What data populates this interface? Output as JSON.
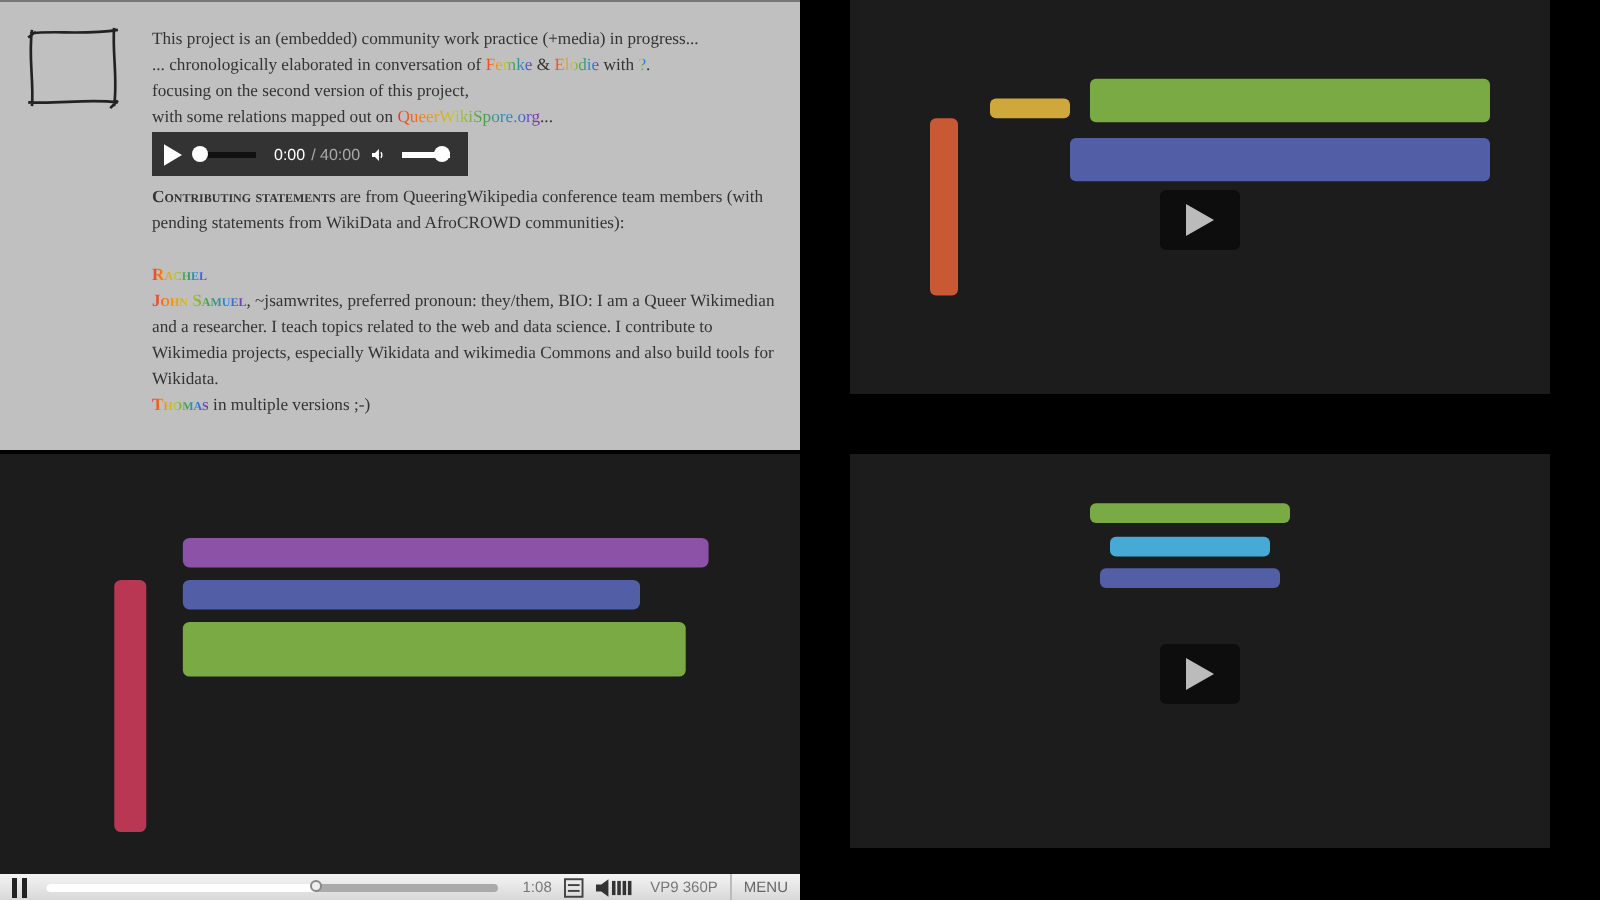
{
  "intro": {
    "lines": [
      [
        {
          "kind": "plain",
          "text": "This project is an (embedded) community work practice (+media) in progress..."
        }
      ],
      [
        {
          "kind": "plain",
          "text": "... chronologically elaborated in conversation of "
        },
        {
          "kind": "link",
          "text": "Femke"
        },
        {
          "kind": "plain",
          "text": " & "
        },
        {
          "kind": "link",
          "text": "Elodie"
        },
        {
          "kind": "plain",
          "text": " with "
        },
        {
          "kind": "link",
          "text": "?"
        },
        {
          "kind": "plain",
          "text": "."
        }
      ],
      [
        {
          "kind": "plain",
          "text": "focusing on the second version of this project,"
        }
      ],
      [
        {
          "kind": "plain",
          "text": "with some relations mapped out on "
        },
        {
          "kind": "link",
          "text": "QueerWikiSpore.org"
        },
        {
          "kind": "plain",
          "text": "..."
        }
      ]
    ]
  },
  "audio": {
    "playing": false,
    "seek": {
      "level": 0
    },
    "time": "0:00",
    "duration": "/ 40:00",
    "muted": false,
    "volume_slider": {
      "level": 1
    }
  },
  "statements": [
    [
      {
        "kind": "heading",
        "text": "Contributing statements"
      },
      {
        "kind": "plain",
        "text": " are from QueeringWikipedia conference team members (with pending statements from WikiData and AfroCROWD communities):"
      }
    ],
    [
      {
        "kind": "name",
        "text": "Rachel"
      }
    ],
    [
      {
        "kind": "name",
        "text": "John Samuel"
      },
      {
        "kind": "plain",
        "text": ", ~jsamwrites, preferred pronoun: they/them, BIO: I am a Queer Wikimedian and a researcher. I teach topics related to the web and data science. I contribute to Wikimedia projects, especially Wikidata and wikimedia Commons and also build tools for Wikidata."
      }
    ],
    [
      {
        "kind": "name",
        "text": "Thomas"
      },
      {
        "kind": "plain",
        "text": " in multiple versions ;-)"
      }
    ]
  ],
  "videos": [
    {
      "kind": "picture",
      "playing": false
    },
    {
      "kind": "picture",
      "playing": true,
      "controls": {
        "playing": true,
        "level": 0.6,
        "time": "1:08",
        "captions": true,
        "quality": "VP9 360P",
        "menu": "MENU"
      }
    },
    {
      "kind": "picture",
      "playing": false
    }
  ]
}
